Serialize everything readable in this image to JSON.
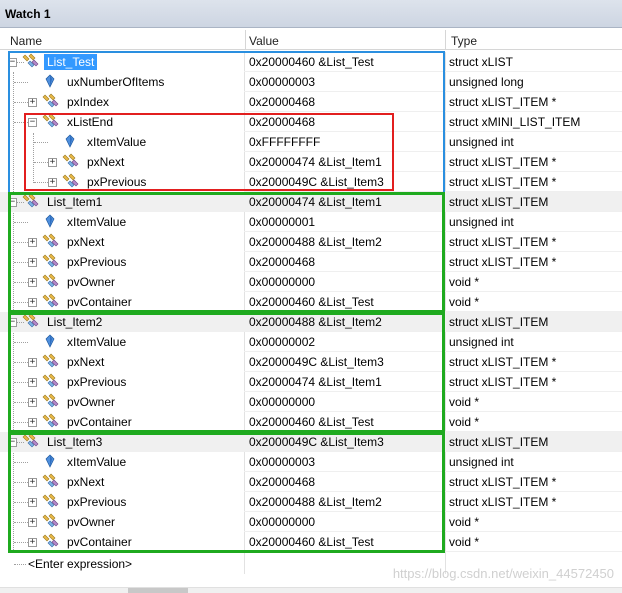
{
  "window": {
    "title": "Watch 1"
  },
  "columns": {
    "name": "Name",
    "value": "Value",
    "type": "Type"
  },
  "rows": [
    {
      "name": "List_Test",
      "value": "0x20000460 &List_Test",
      "type": "struct xLIST"
    },
    {
      "name": "uxNumberOfItems",
      "value": "0x00000003",
      "type": "unsigned long"
    },
    {
      "name": "pxIndex",
      "value": "0x20000468",
      "type": "struct xLIST_ITEM *"
    },
    {
      "name": "xListEnd",
      "value": "0x20000468",
      "type": "struct xMINI_LIST_ITEM"
    },
    {
      "name": "xItemValue",
      "value": "0xFFFFFFFF",
      "type": "unsigned int"
    },
    {
      "name": "pxNext",
      "value": "0x20000474 &List_Item1",
      "type": "struct xLIST_ITEM *"
    },
    {
      "name": "pxPrevious",
      "value": "0x2000049C &List_Item3",
      "type": "struct xLIST_ITEM *"
    },
    {
      "name": "List_Item1",
      "value": "0x20000474 &List_Item1",
      "type": "struct xLIST_ITEM"
    },
    {
      "name": "xItemValue",
      "value": "0x00000001",
      "type": "unsigned int"
    },
    {
      "name": "pxNext",
      "value": "0x20000488 &List_Item2",
      "type": "struct xLIST_ITEM *"
    },
    {
      "name": "pxPrevious",
      "value": "0x20000468",
      "type": "struct xLIST_ITEM *"
    },
    {
      "name": "pvOwner",
      "value": "0x00000000",
      "type": "void *"
    },
    {
      "name": "pvContainer",
      "value": "0x20000460 &List_Test",
      "type": "void *"
    },
    {
      "name": "List_Item2",
      "value": "0x20000488 &List_Item2",
      "type": "struct xLIST_ITEM"
    },
    {
      "name": "xItemValue",
      "value": "0x00000002",
      "type": "unsigned int"
    },
    {
      "name": "pxNext",
      "value": "0x2000049C &List_Item3",
      "type": "struct xLIST_ITEM *"
    },
    {
      "name": "pxPrevious",
      "value": "0x20000474 &List_Item1",
      "type": "struct xLIST_ITEM *"
    },
    {
      "name": "pvOwner",
      "value": "0x00000000",
      "type": "void *"
    },
    {
      "name": "pvContainer",
      "value": "0x20000460 &List_Test",
      "type": "void *"
    },
    {
      "name": "List_Item3",
      "value": "0x2000049C &List_Item3",
      "type": "struct xLIST_ITEM"
    },
    {
      "name": "xItemValue",
      "value": "0x00000003",
      "type": "unsigned int"
    },
    {
      "name": "pxNext",
      "value": "0x20000468",
      "type": "struct xLIST_ITEM *"
    },
    {
      "name": "pxPrevious",
      "value": "0x20000488 &List_Item2",
      "type": "struct xLIST_ITEM *"
    },
    {
      "name": "pvOwner",
      "value": "0x00000000",
      "type": "void *"
    },
    {
      "name": "pvContainer",
      "value": "0x20000460 &List_Test",
      "type": "void *"
    }
  ],
  "enter_expression": "<Enter expression>",
  "watermark": "https://blog.csdn.net/weixin_44572450",
  "colors": {
    "blue_box": "#2a8fe0",
    "red_box": "#e21f1f",
    "green_box": "#1faa1f",
    "selection": "#3399ff"
  }
}
